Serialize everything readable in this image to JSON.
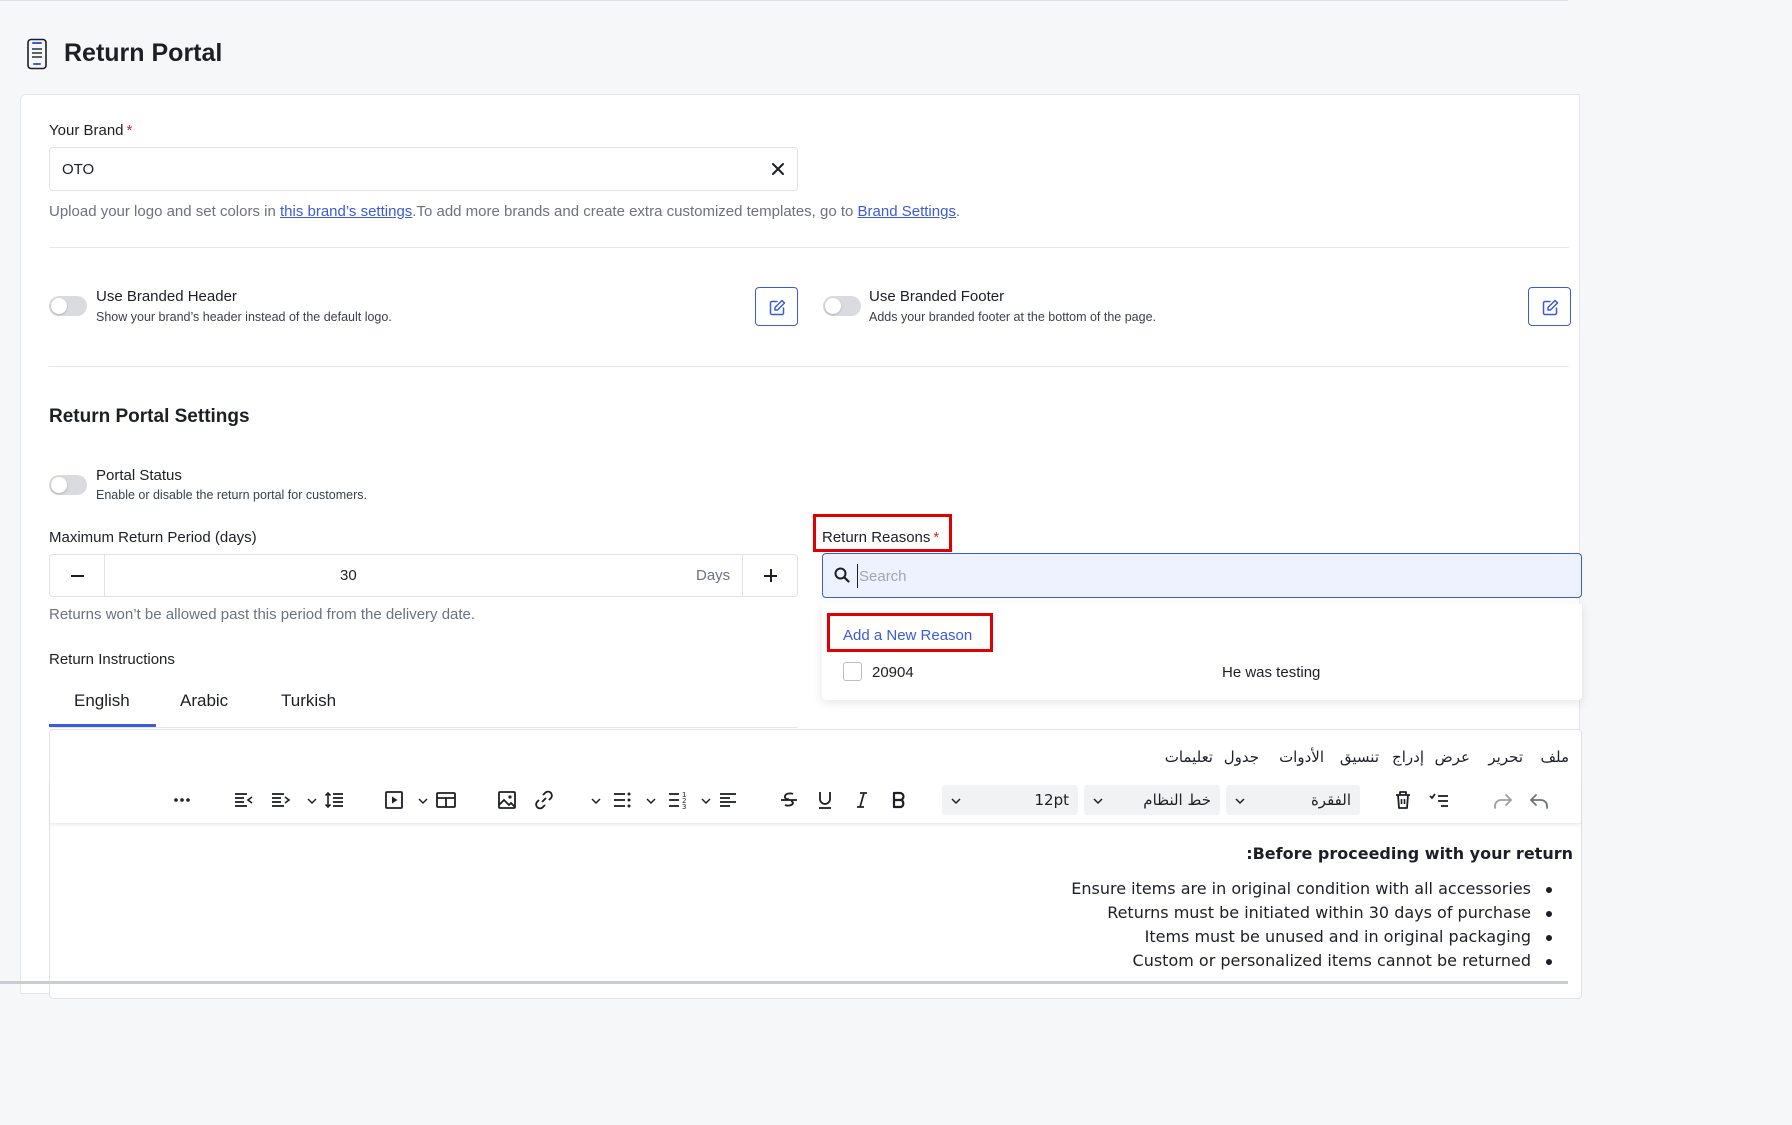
{
  "page": {
    "title": "Return Portal"
  },
  "brand": {
    "label": "Your Brand",
    "required_mark": "*",
    "value": "OTO",
    "hint_prefix": "Upload your logo and set colors in ",
    "hint_link1": "this brand’s settings",
    "hint_middle": ".To add more brands and create extra customized templates, go to ",
    "hint_link2": "Brand Settings",
    "hint_suffix": "."
  },
  "branding": {
    "header": {
      "title": "Use Branded Header",
      "description": "Show your brand’s header instead of the default logo.",
      "enabled": false
    },
    "footer": {
      "title": "Use Branded Footer",
      "description": "Adds your branded footer at the bottom of the page.",
      "enabled": false
    }
  },
  "settings": {
    "title": "Return Portal Settings",
    "portal_status": {
      "title": "Portal Status",
      "description": "Enable or disable the return portal for customers.",
      "enabled": false
    },
    "max_period": {
      "label": "Maximum Return Period (days)",
      "value": "30",
      "unit": "Days",
      "hint": "Returns won’t be allowed past this period from the delivery date."
    },
    "instructions": {
      "label": "Return Instructions",
      "tabs": [
        {
          "label": "English",
          "active": true
        },
        {
          "label": "Arabic",
          "active": false
        },
        {
          "label": "Turkish",
          "active": false
        }
      ]
    }
  },
  "reasons": {
    "label": "Return Reasons",
    "required_mark": "*",
    "search_placeholder": "Search",
    "add_label": "Add a New Reason",
    "items": [
      {
        "code": "20904",
        "description": "He was testing",
        "checked": false
      }
    ]
  },
  "editor": {
    "menu": [
      "ملف",
      "تحرير",
      "عرض",
      "إدراج",
      "تنسيق",
      "الأدوات",
      "جدول",
      "تعليمات"
    ],
    "block_format": "الفقرة",
    "font_family": "خط النظام",
    "font_size": "12pt",
    "content": {
      "heading": "Before proceeding with your return:",
      "bullets": [
        "Ensure items are in original condition with all accessories",
        "Returns must be initiated within 30 days of purchase",
        "Items must be unused and in original packaging",
        "Custom or personalized items cannot be returned"
      ]
    }
  },
  "colors": {
    "accent": "#3b5bdb",
    "highlight_box": "#e00000",
    "required": "#e02424"
  },
  "icons": [
    "phone-document-icon",
    "close-icon",
    "edit-icon",
    "search-icon",
    "undo-icon",
    "redo-icon",
    "delete-icon",
    "bold-icon",
    "italic-icon",
    "underline-icon",
    "strikethrough-icon",
    "align-icon",
    "list-icon",
    "link-icon",
    "image-icon",
    "table-icon",
    "media-icon",
    "line-height-icon",
    "indent-icon",
    "outdent-icon",
    "more-icon"
  ]
}
